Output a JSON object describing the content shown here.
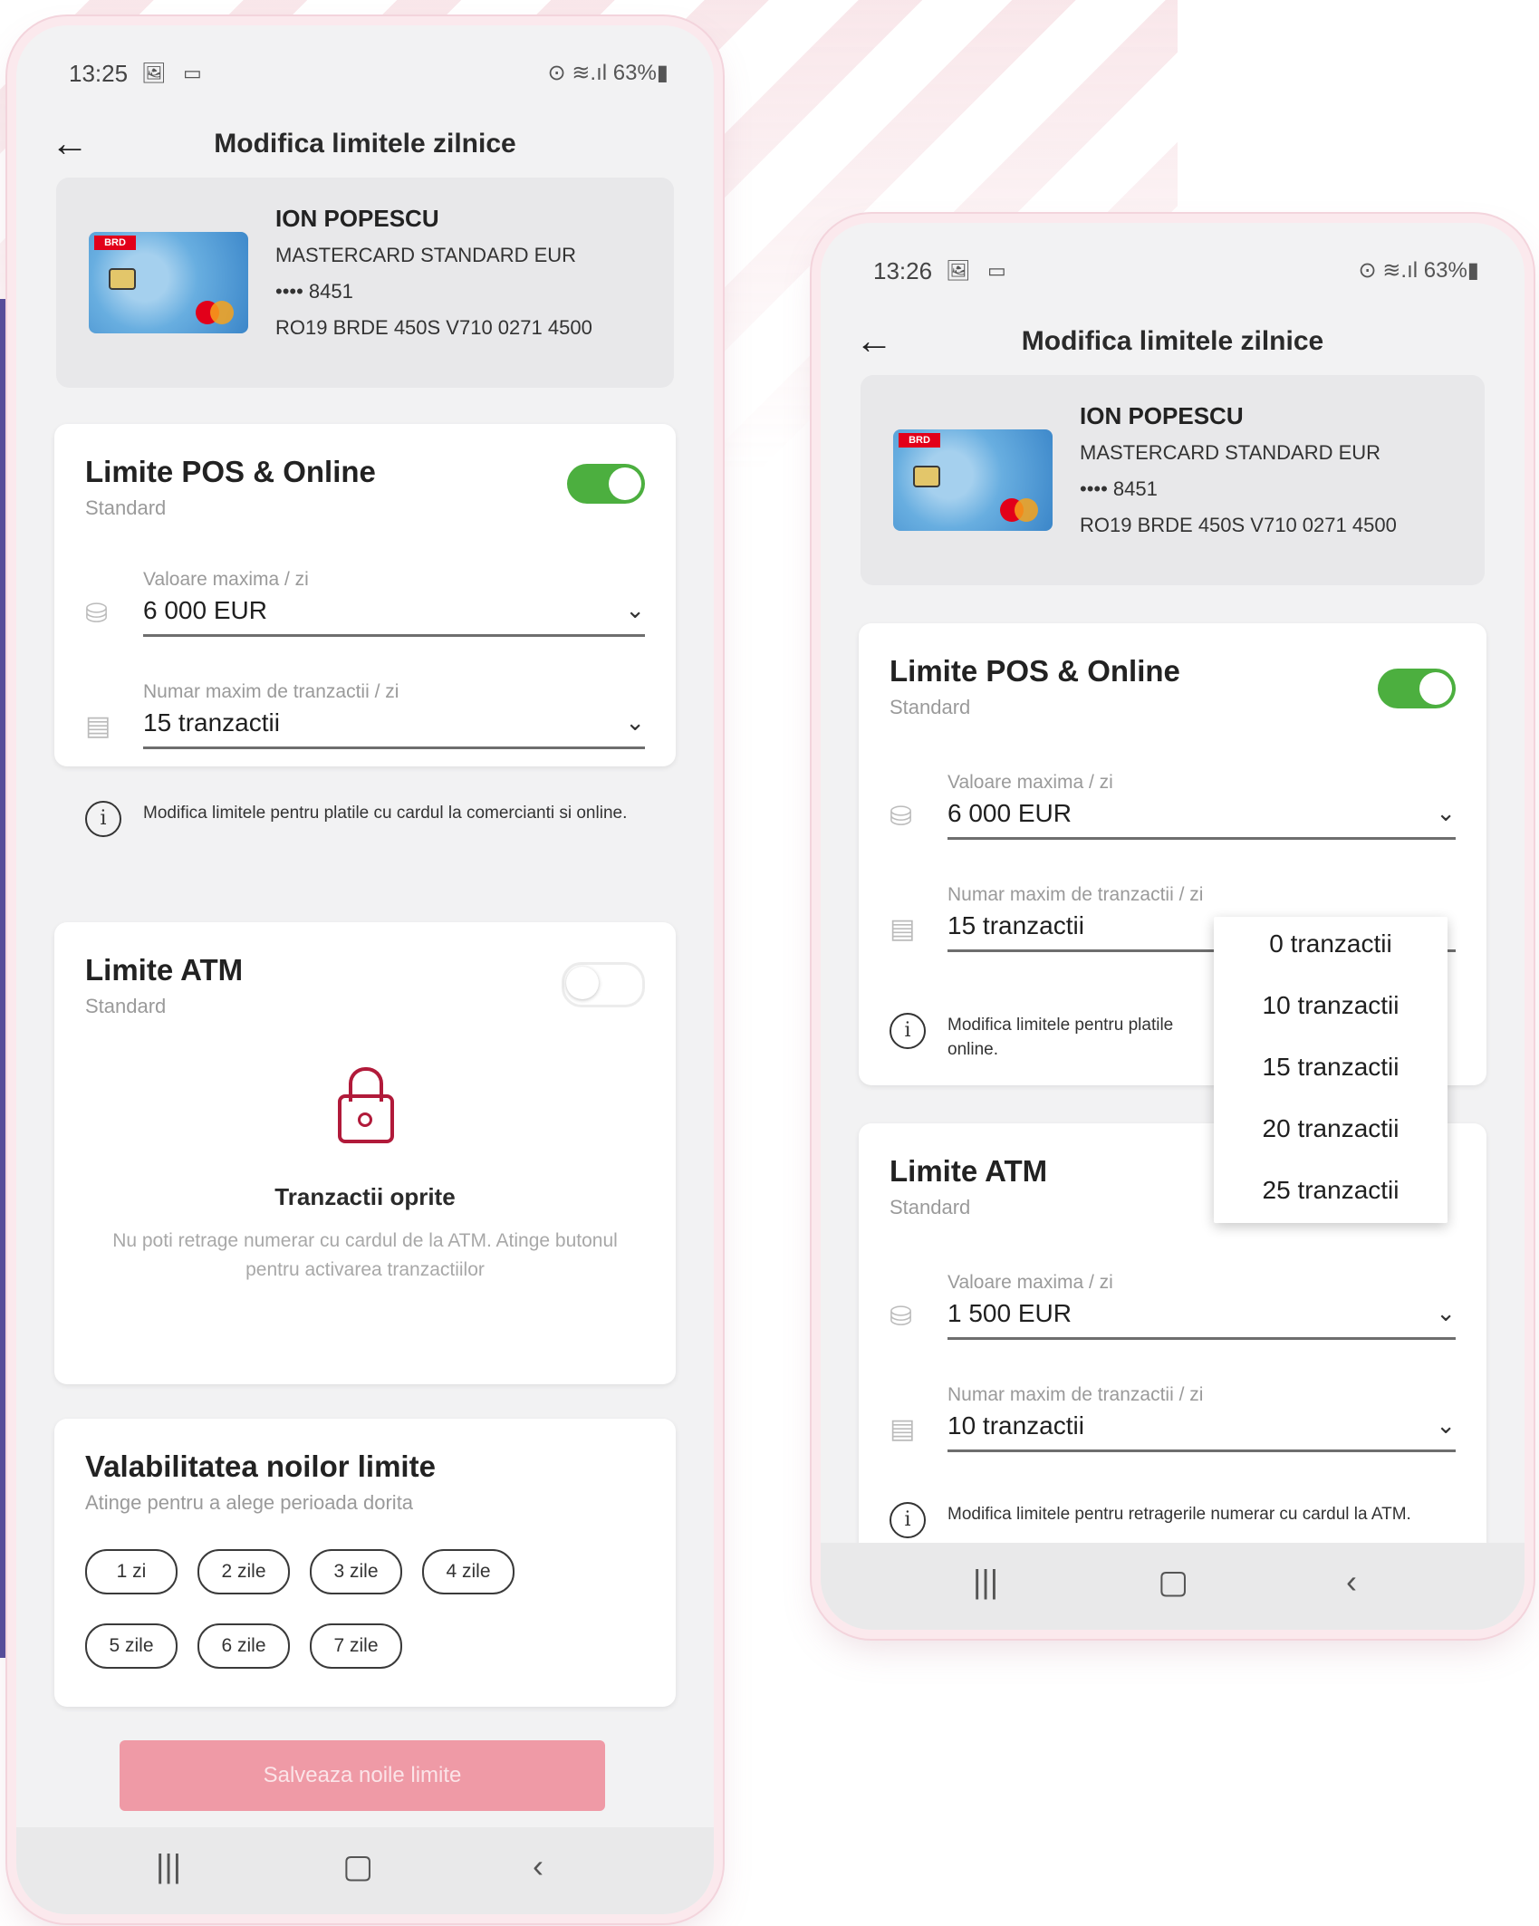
{
  "screens": [
    {
      "status": {
        "time": "13:25",
        "left_icons": "🖼 ▭",
        "right_icons": "⊙ ≋.ıl 63%▮"
      },
      "title": "Modifica limitele zilnice",
      "card": {
        "name": "ION POPESCU",
        "type": "MASTERCARD STANDARD EUR",
        "number": "•••• 8451",
        "iban": "RO19 BRDE 450S V710 0271 4500",
        "brand_text": "BRD"
      },
      "pos": {
        "title": "Limite POS & Online",
        "subtitle": "Standard",
        "toggle": "on",
        "amount_label": "Valoare maxima / zi",
        "amount_value": "6 000 EUR",
        "count_label": "Numar maxim de tranzactii / zi",
        "count_value": "15 tranzactii",
        "info": "Modifica limitele pentru platile cu cardul la comercianti si online."
      },
      "atm": {
        "title": "Limite ATM",
        "subtitle": "Standard",
        "toggle": "off",
        "locked_title": "Tranzactii oprite",
        "locked_text": "Nu poti retrage numerar cu cardul de la ATM. Atinge butonul pentru activarea tranzactiilor"
      },
      "validity": {
        "title": "Valabilitatea noilor limite",
        "subtitle": "Atinge pentru a alege perioada dorita",
        "options": [
          "1 zi",
          "2 zile",
          "3 zile",
          "4 zile",
          "5 zile",
          "6 zile",
          "7 zile"
        ]
      },
      "save_label": "Salveaza noile limite",
      "nav": {
        "recent": "|||",
        "home": "▢",
        "back": "‹"
      }
    },
    {
      "status": {
        "time": "13:26",
        "left_icons": "🖼 ▭",
        "right_icons": "⊙ ≋.ıl 63%▮"
      },
      "title": "Modifica limitele zilnice",
      "card": {
        "name": "ION POPESCU",
        "type": "MASTERCARD STANDARD EUR",
        "number": "•••• 8451",
        "iban": "RO19 BRDE 450S V710 0271 4500",
        "brand_text": "BRD"
      },
      "pos": {
        "title": "Limite POS & Online",
        "subtitle": "Standard",
        "toggle": "on",
        "amount_label": "Valoare maxima / zi",
        "amount_value": "6 000 EUR",
        "count_label": "Numar maxim de tranzactii / zi",
        "count_value": "15 tranzactii",
        "info_visible": "Modifica limitele pentru platile",
        "info_line2": "online."
      },
      "dropdown": {
        "options": [
          "0 tranzactii",
          "10 tranzactii",
          "15 tranzactii",
          "20 tranzactii",
          "25 tranzactii"
        ]
      },
      "atm": {
        "title": "Limite ATM",
        "subtitle": "Standard",
        "amount_label": "Valoare maxima / zi",
        "amount_value": "1 500 EUR",
        "count_label": "Numar maxim de tranzactii / zi",
        "count_value": "10 tranzactii",
        "info": "Modifica limitele pentru retragerile numerar cu cardul la ATM."
      },
      "nav": {
        "recent": "|||",
        "home": "▢",
        "back": "‹"
      }
    }
  ],
  "colors": {
    "toggle_on": "#4caf3f",
    "save_button": "#ef9aa6",
    "lock": "#b11a3a",
    "accent_purple": "#524c9b"
  }
}
